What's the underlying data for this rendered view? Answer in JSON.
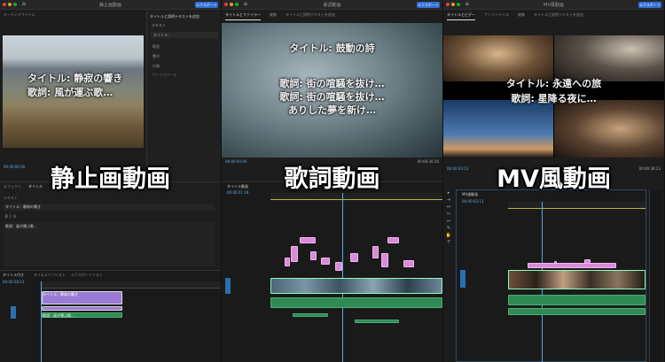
{
  "panels": [
    {
      "window_title": "静止画動画",
      "export_label": "エクスポート",
      "label": "静止画動画",
      "caption_title": "タイトル: 静寂の響き",
      "caption_lyrics": "歌詞: 風が運ぶ歌…",
      "source_tab": "オーディオファイル",
      "sidebar_header": "タイトルと説明テキストを追加",
      "sidebar_section": "テキスト",
      "sidebar_dropdown": "タイトル：",
      "sidebar_items": [
        "範囲",
        "整列",
        "外観",
        "ワークスペース"
      ],
      "timecode": "00:00:00:00",
      "editor_tabs": [
        "エフェクト",
        "タイトル",
        "音声"
      ],
      "editor_heading": "テキスト",
      "editor_title_value": "タイトル：静寂の響き",
      "editor_body_value": "歌詞：風が運ぶ歌…",
      "timeline_tabs": [
        "タイトル付き",
        "タイムラインリスト",
        "エクスポートリスト"
      ],
      "timeline_timecode": "00:00:28:12",
      "clip_title": "タイトル：静寂の響き",
      "clip_lyrics": "歌詞：風が運ぶ歌…"
    },
    {
      "window_title": "歌詞動画",
      "export_label": "エクスポート",
      "label": "歌詞動画",
      "tabs": [
        "タイトルとファイラー",
        "編集",
        "タイトルと説明テキストを追加"
      ],
      "caption_title": "タイトル: 鼓動の詩",
      "caption_lyrics": [
        "歌詞: 街の喧騒を抜け…",
        "歌詞: 街の喧騒を抜け…",
        "ありした夢を新け…"
      ],
      "timecode": "00:00:00:00",
      "timecode_end": "00:00:30:16",
      "timeline_name": "タイトル動画",
      "timeline_timecode": "00:00:21:18"
    },
    {
      "window_title": "MV風動画",
      "export_label": "エクスポート",
      "label": "MV風動画",
      "tabs": [
        "タイトルとビデー",
        "ファインドイル",
        "編集",
        "タイトルと説明テキストを追加"
      ],
      "caption_title": "タイトル: 永遠への旅",
      "caption_lyrics": "歌詞: 星降る夜に…",
      "timecode": "00:00:03:13",
      "timecode_end": "00:00:38:23",
      "timeline_name": "MV風動画",
      "timeline_timecode": "00:00:03:13"
    }
  ],
  "colors": {
    "accent": "#2f6fd6",
    "title_clip": "#d98ad9",
    "audio_clip": "#2f8a55",
    "playhead": "#5aa9e6"
  }
}
